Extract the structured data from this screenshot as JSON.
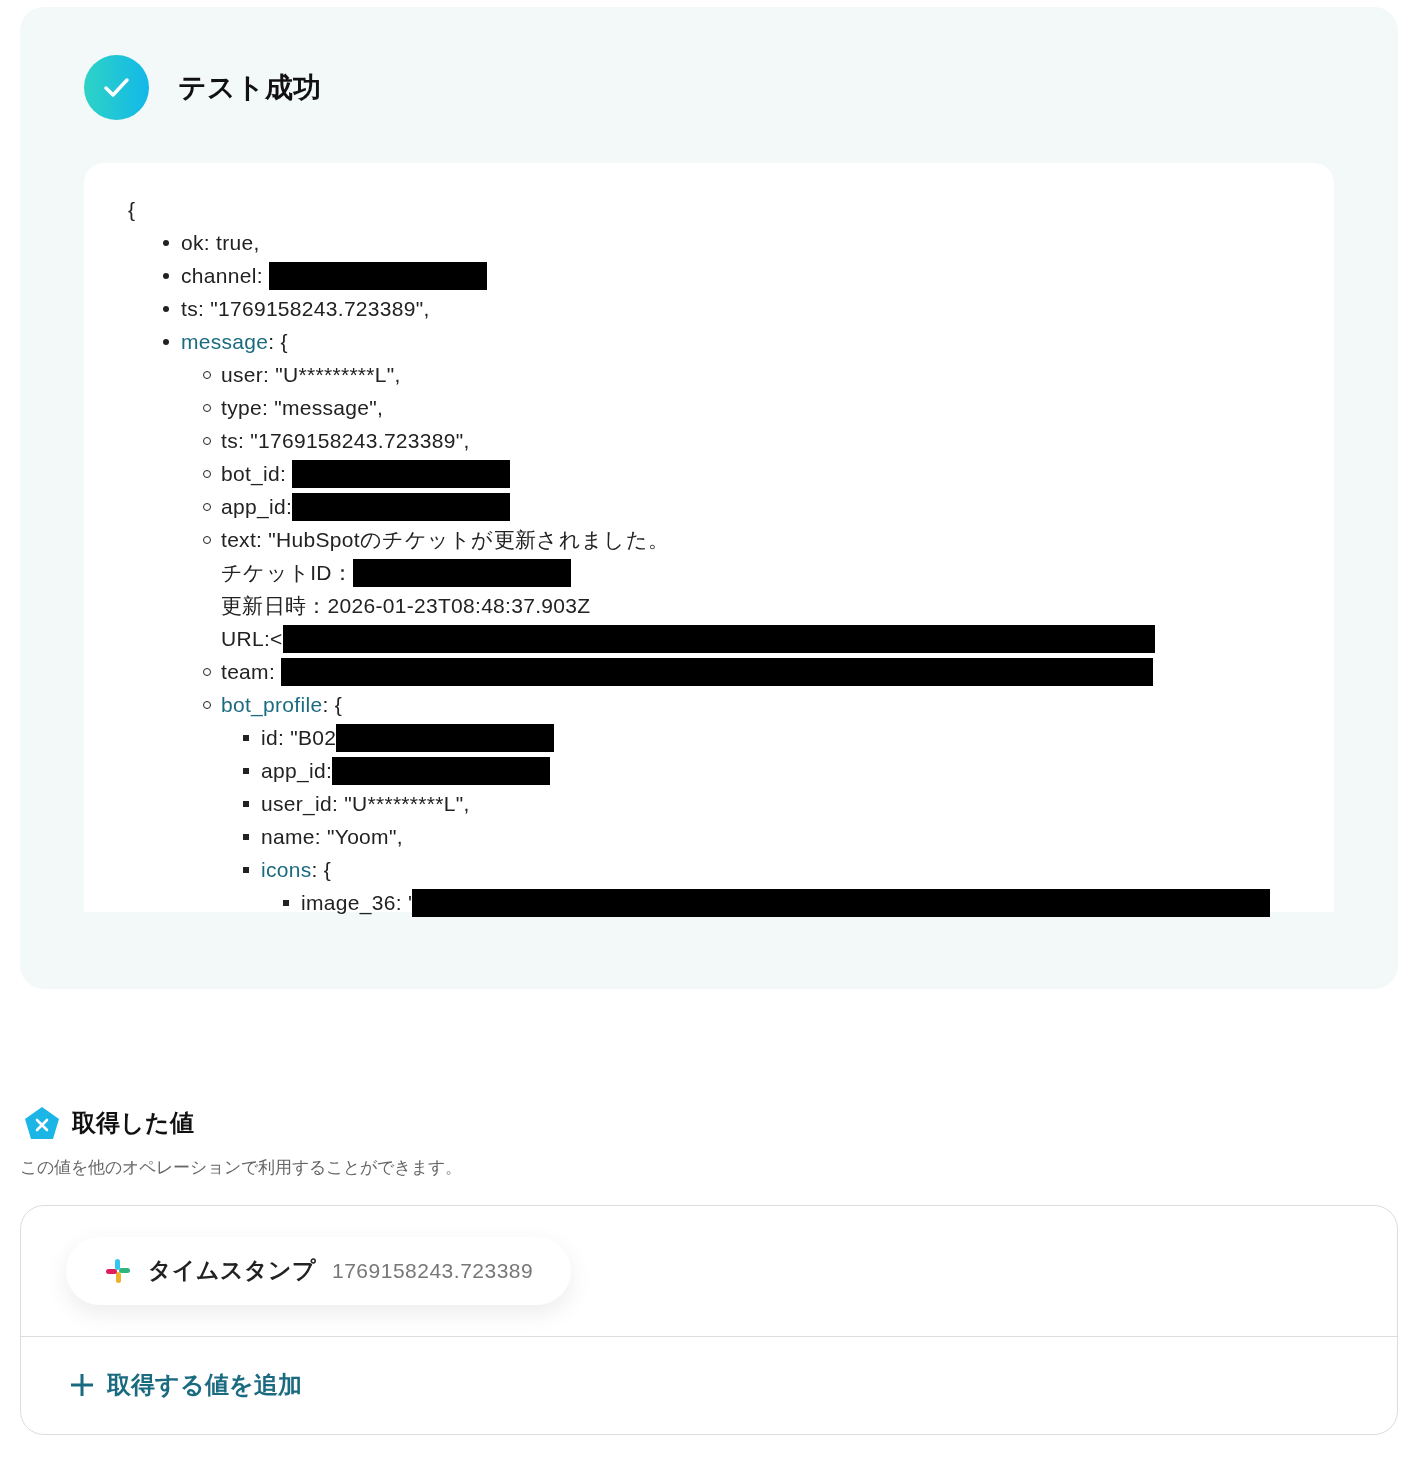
{
  "result": {
    "title": "テスト成功",
    "open_brace": "{",
    "items": [
      {
        "key": "ok",
        "value": ": true,",
        "object": false,
        "kind": "plain"
      },
      {
        "key": "channel",
        "value": ": ",
        "object": false,
        "kind": "redacted_short"
      },
      {
        "key": "ts",
        "value": ": \"1769158243.723389\",",
        "object": false,
        "kind": "plain"
      },
      {
        "key": "message",
        "value": ": {",
        "object": true,
        "kind": "plain",
        "children": [
          {
            "key": "user",
            "value": ": \"U*********L\",",
            "object": false,
            "kind": "plain"
          },
          {
            "key": "type",
            "value": ": \"message\",",
            "object": false,
            "kind": "plain"
          },
          {
            "key": "ts",
            "value": ": \"1769158243.723389\",",
            "object": false,
            "kind": "plain"
          },
          {
            "key": "bot_id",
            "value": ": ",
            "object": false,
            "kind": "redacted_short"
          },
          {
            "key": "app_id",
            "value": ":",
            "object": false,
            "kind": "redacted_short"
          },
          {
            "key": "text",
            "value": ": \"HubSpotのチケットが更新されました。",
            "object": false,
            "kind": "plain",
            "continuation": [
              {
                "text": "チケットID：",
                "kind": "redacted_short"
              },
              {
                "text": "更新日時：2026-01-23T08:48:37.903Z",
                "kind": "plain"
              },
              {
                "text": "URL:<",
                "kind": "redacted_long"
              }
            ]
          },
          {
            "key": "team",
            "value": ": ",
            "object": false,
            "kind": "redacted_long"
          },
          {
            "key": "bot_profile",
            "value": ": {",
            "object": true,
            "kind": "plain",
            "children": [
              {
                "key": "id",
                "value": ": \"B02",
                "object": false,
                "kind": "redacted_short"
              },
              {
                "key": "app_id",
                "value": ":",
                "object": false,
                "kind": "redacted_short"
              },
              {
                "key": "user_id",
                "value": ": \"U*********L\",",
                "object": false,
                "kind": "plain"
              },
              {
                "key": "name",
                "value": ": \"Yoom\",",
                "object": false,
                "kind": "plain"
              },
              {
                "key": "icons",
                "value": ": {",
                "object": true,
                "kind": "plain",
                "children": [
                  {
                    "key": "image_36",
                    "value": ": '",
                    "object": false,
                    "kind": "redacted_full"
                  }
                ]
              }
            ]
          }
        ]
      }
    ]
  },
  "values": {
    "title": "取得した値",
    "description": "この値を他のオペレーションで利用することができます。",
    "chips": [
      {
        "label": "タイムスタンプ",
        "value": "1769158243.723389"
      }
    ],
    "add_button": "取得する値を追加"
  }
}
